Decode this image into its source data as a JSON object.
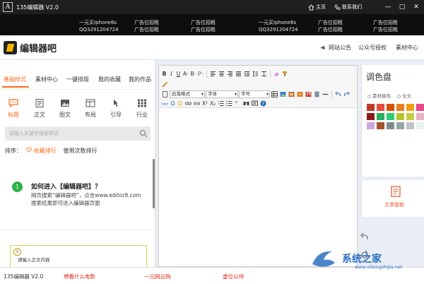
{
  "titlebar": {
    "logo_letter": "A",
    "title": "135编辑器  V2.0",
    "home": "主页",
    "contact": "联系我们",
    "controls": [
      "—",
      "▢",
      "✕"
    ]
  },
  "adbar": {
    "ads": [
      [
        "一元买Iphone6s",
        "QQ3291204724"
      ],
      [
        "广告位招租",
        "广告位招租"
      ],
      [
        "广告位招租",
        "广告位招租"
      ],
      [
        "一元买Iphone6s",
        "QQ3291204724"
      ],
      [
        "广告位招租",
        "广告位招租"
      ],
      [
        "广告位招租",
        "广告位招租"
      ]
    ]
  },
  "header": {
    "brand": "编辑器吧",
    "nav": [
      "网站公告",
      "公众号授权",
      "素材中心"
    ]
  },
  "left": {
    "tabs": [
      "基础样式",
      "素材中心",
      "一键排版",
      "我的收藏",
      "我的作品"
    ],
    "categories": [
      "标题",
      "正文",
      "图文",
      "布局",
      "引导",
      "行业"
    ],
    "search_placeholder": "请输入关键字搜索样式",
    "sort_label": "排序：",
    "sort_options": [
      "收藏排行",
      "使用次数排行"
    ],
    "guide": {
      "num": "1",
      "title": "如何进入【编辑器吧】？",
      "text": "网页搜索“编辑器吧”，点击www.editor8.com搜索结果即可进入编辑器页面"
    },
    "card": {
      "badge": "①",
      "text": "请输入正文内容"
    }
  },
  "editor": {
    "row1": [
      "B",
      "I",
      "U",
      "A·",
      "B·",
      "ℙ·"
    ],
    "dropdowns": {
      "paragraph": "段落格式",
      "font": "字体",
      "size": "字号"
    },
    "row3_text": [
      "Ω",
      "☺",
      "X²",
      "X₂"
    ]
  },
  "palette": {
    "title": "调色盘",
    "tabs": [
      "素材换色",
      "全文"
    ],
    "colors": [
      "#c0392b",
      "#e74c3c",
      "#d35400",
      "#e67e22",
      "#f39c12",
      "#e8488a",
      "#8b1a1a",
      "#27ae60",
      "#2ecc71",
      "#b5c332",
      "#c9cc3f",
      "#e8b3c6",
      "#c9a7e0",
      "#a0522d",
      "#7f8c8d",
      "#95a5a6",
      "#bdc3c7",
      "#ecf0f1"
    ]
  },
  "extract": {
    "label": "文章提取"
  },
  "statusbar": {
    "version": "135编辑器  V2.0",
    "links": [
      "想看什么电影",
      "一元网云购",
      "虚位以待"
    ]
  },
  "watermark": {
    "brand": "系统之家",
    "url": "www.xitongzhijia.net"
  }
}
